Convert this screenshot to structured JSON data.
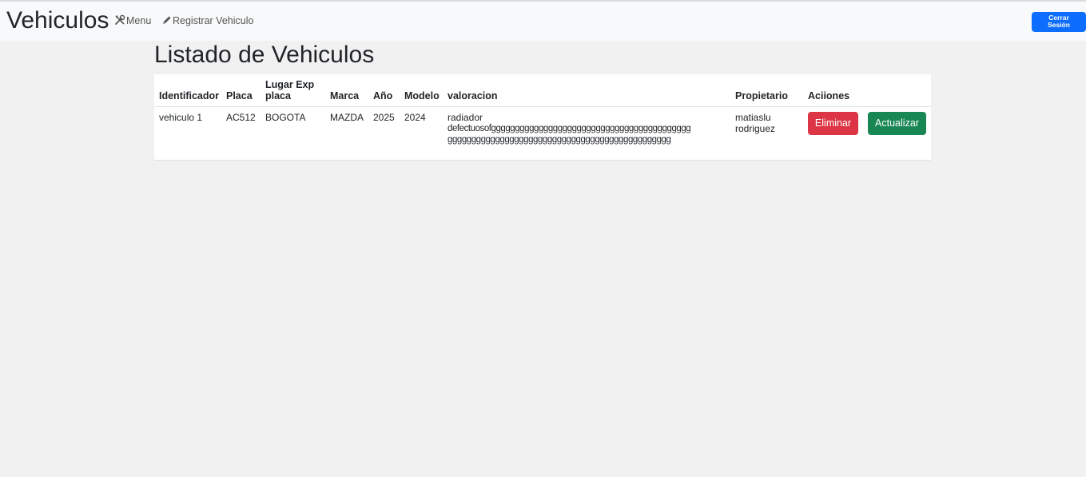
{
  "navbar": {
    "brand": "Vehiculos",
    "menu_label": "Menu",
    "menu_icon": "tools-icon",
    "registrar_label": "Registrar Vehiculo",
    "registrar_icon": "pencil-icon",
    "logout_line1": "Cerrar",
    "logout_line2": "Sesión"
  },
  "page": {
    "title": "Listado de Vehiculos"
  },
  "table": {
    "headers": {
      "identificador": "Identificador",
      "placa": "Placa",
      "lugar_line1": "Lugar Exp",
      "lugar_line2": "placa",
      "marca": "Marca",
      "anio": "Año",
      "modelo": "Modelo",
      "valoracion": "valoracion",
      "propietario": "Propietario",
      "acciones": "Aciiones"
    },
    "rows": [
      {
        "identificador": "vehiculo 1",
        "placa": "AC512",
        "lugar": "BOGOTA",
        "marca": "MAZDA",
        "anio": "2025",
        "modelo": "2024",
        "valoracion_line1": "radiador",
        "valoracion_line2": "defectuosofgggggggggggggggggggggggggggggggggggggggggg",
        "valoracion_line3": "ggggggggggggggggggggggggggggggggggggggggggggggg",
        "propietario_line1": "matiaslu",
        "propietario_line2": "rodriguez",
        "eliminar_label": "Eliminar",
        "actualizar_label": "Actualizar"
      }
    ]
  },
  "colors": {
    "primary": "#0d6efd",
    "danger": "#dc3545",
    "success": "#198754",
    "page_bg": "#f1f1f1",
    "navbar_bg": "#f8f9fa"
  }
}
